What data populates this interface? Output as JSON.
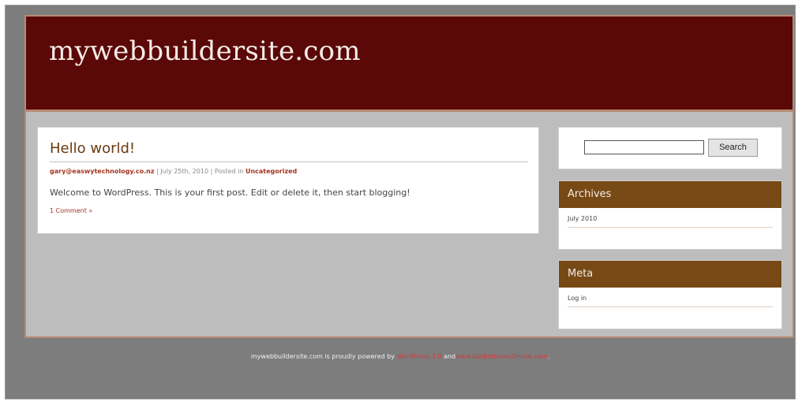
{
  "site": {
    "title": "mywebbuildersite.com"
  },
  "post": {
    "title": "Hello world!",
    "author": "gary@easwytechnology.co.nz",
    "date": "July 25th, 2010",
    "posted_in": "Posted in",
    "category": "Uncategorized",
    "sep": "|",
    "body": "Welcome to WordPress. This is your first post. Edit or delete it, then start blogging!",
    "comments": "1 Comment »"
  },
  "sidebar": {
    "search": {
      "input_value": "",
      "button_label": "Search"
    },
    "archives": {
      "title": "Archives",
      "items": [
        "July 2010"
      ]
    },
    "meta": {
      "title": "Meta",
      "items": [
        "Log in"
      ]
    }
  },
  "footer": {
    "prefix": "mywebbuildersite.com is proudly powered by",
    "wordpress": "WordPress 3.0",
    "and": "and",
    "partner": "www.GaiBottoneyOnline.com",
    "suffix": "."
  },
  "colors": {
    "header_bg": "#5a0808",
    "widget_head_bg": "#774915",
    "link": "#a5331f",
    "page_bg": "#bdbdbd",
    "outer_bg": "#7d7d7d"
  }
}
